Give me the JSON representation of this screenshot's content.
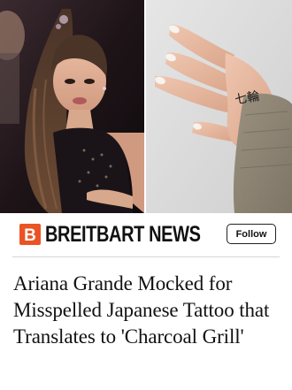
{
  "media": {
    "left_image_subject": "performer-photo",
    "right_image_subject": "hand-tattoo-photo",
    "tattoo_text": "七輪"
  },
  "publisher": {
    "logo_letter": "B",
    "name": "BREITBART NEWS",
    "follow_label": "Follow",
    "brand_color": "#ea5424"
  },
  "article": {
    "headline": "Ariana Grande Mocked for Misspelled Japanese Tattoo that Translates to 'Charcoal Grill'"
  }
}
